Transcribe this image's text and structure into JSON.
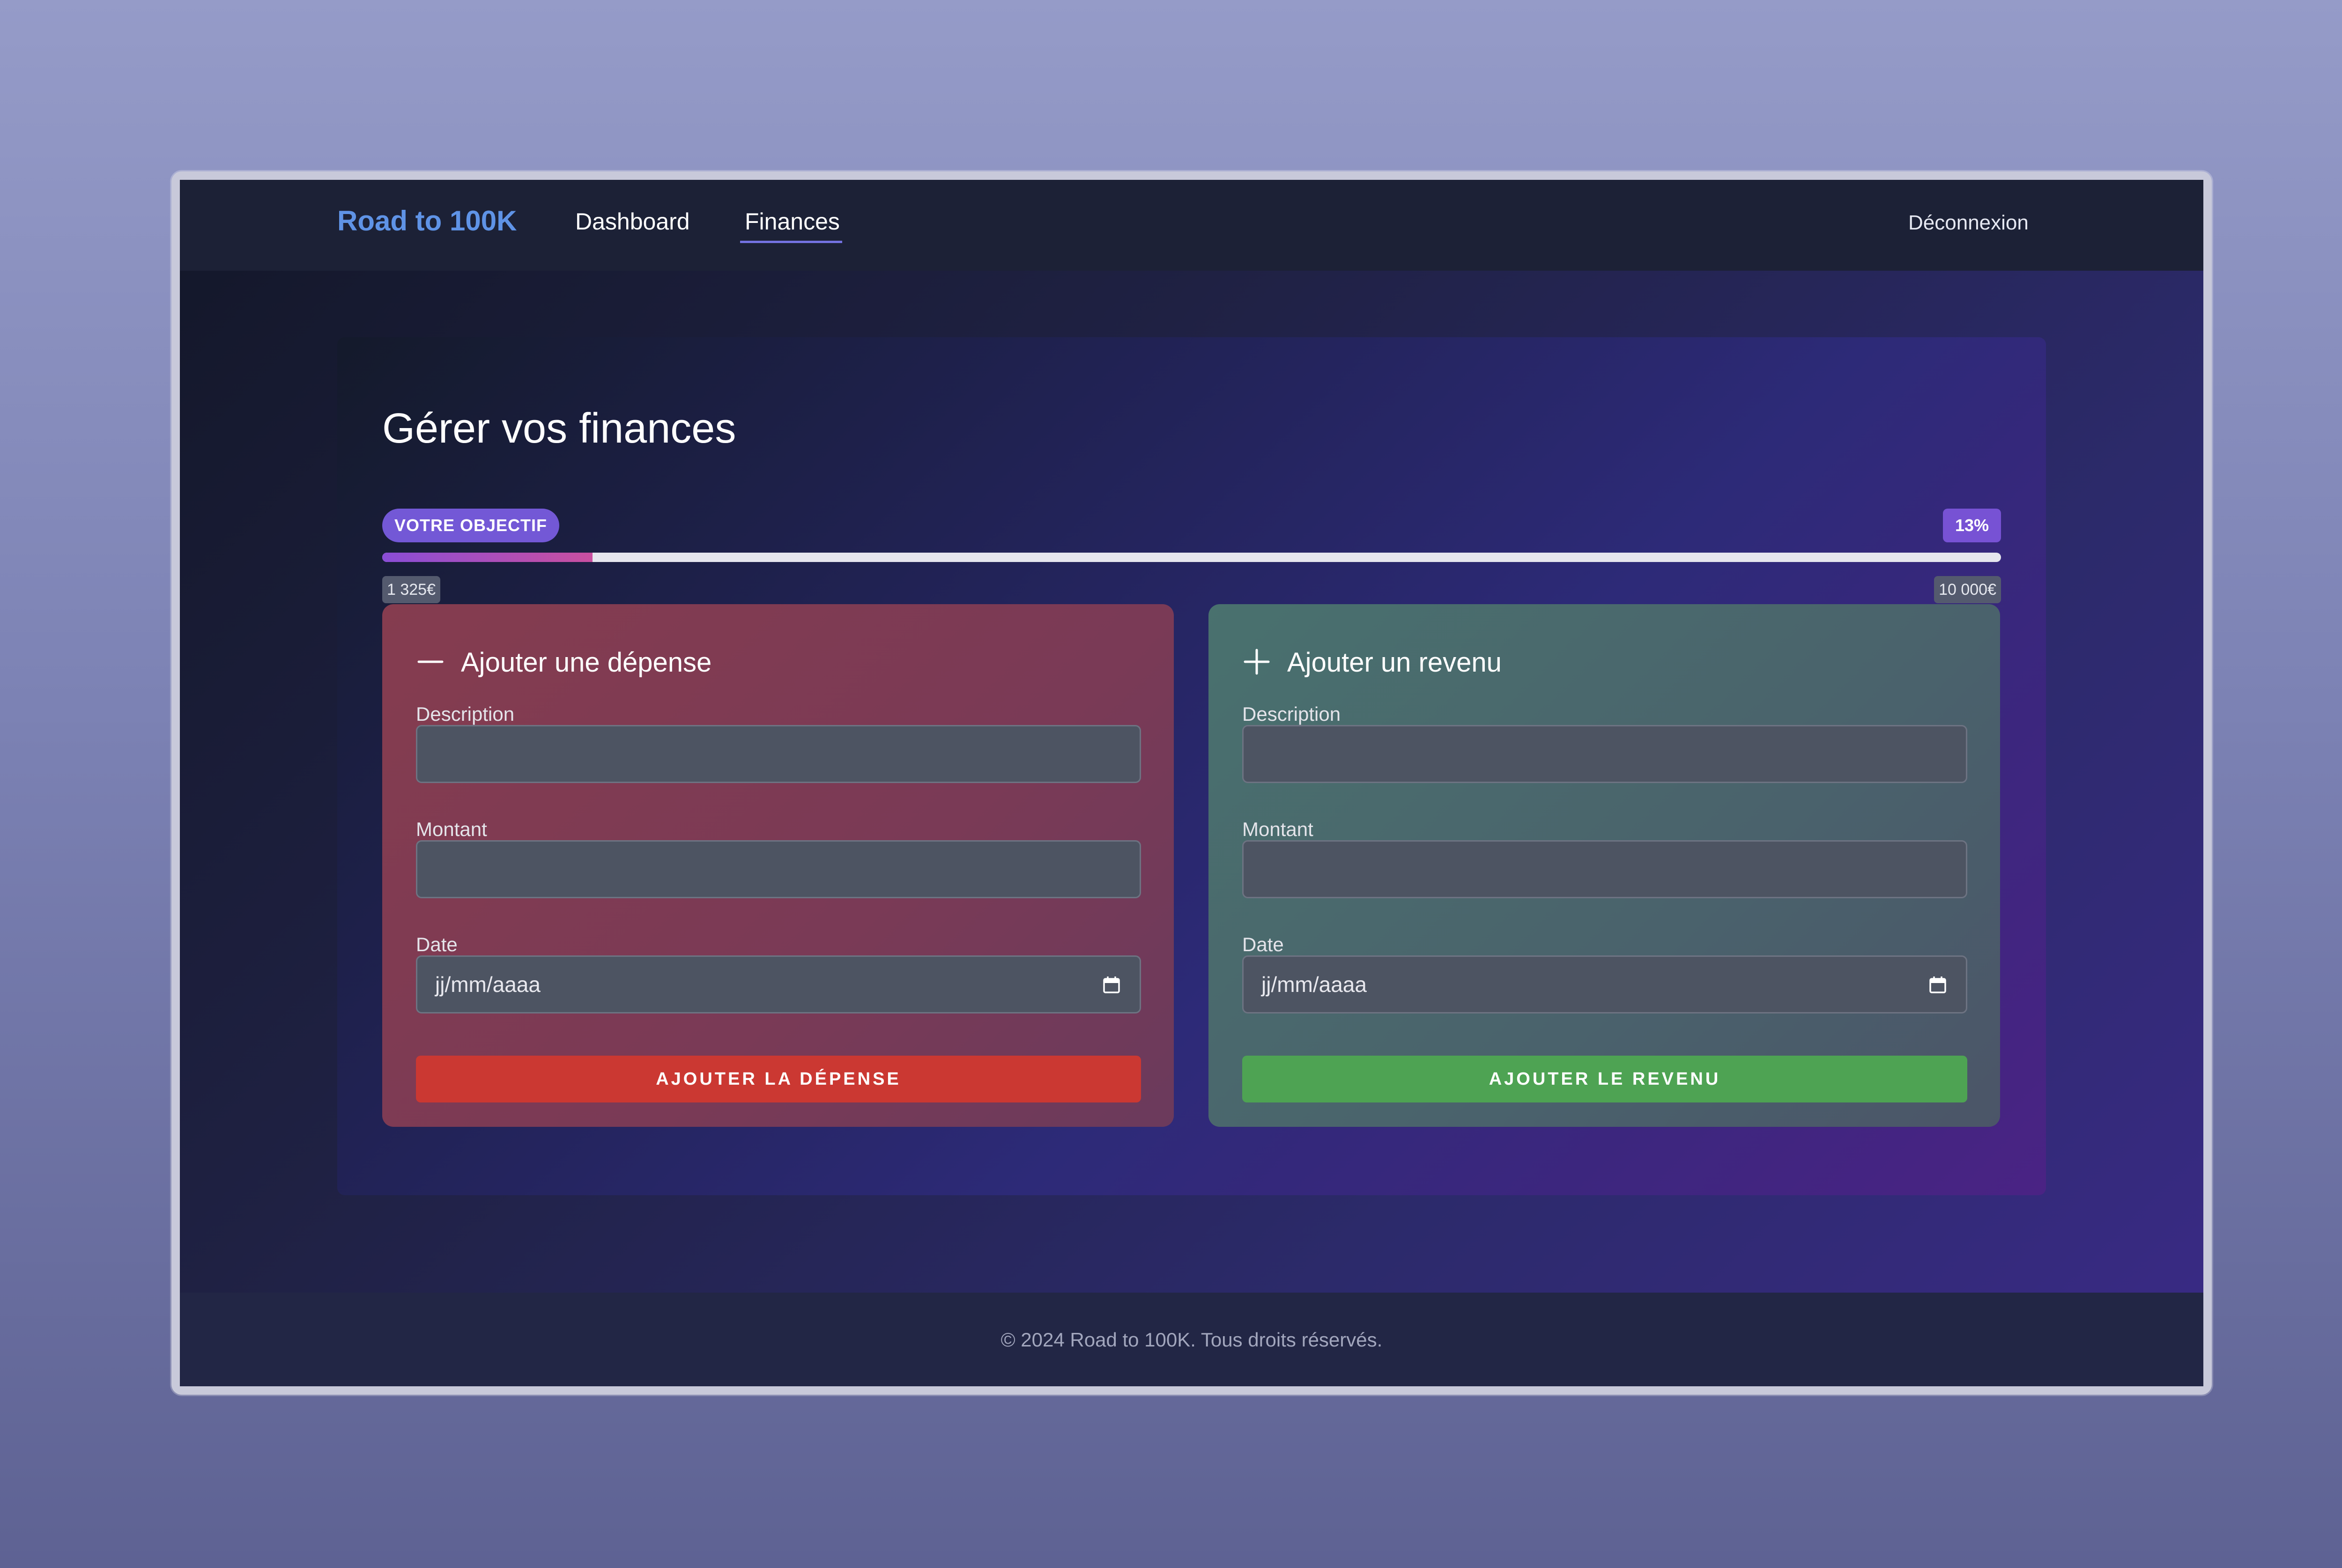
{
  "nav": {
    "brand": "Road to 100K",
    "links": [
      "Dashboard",
      "Finances"
    ],
    "active": "Finances",
    "logout_label": "Déconnexion"
  },
  "page": {
    "title": "Gérer vos finances"
  },
  "goal": {
    "badge_label": "VOTRE OBJECTIF",
    "percent_label": "13%",
    "progress_fraction": 0.13,
    "current_label": "1 325€",
    "target_label": "10 000€"
  },
  "expense": {
    "title": "Ajouter une dépense",
    "icon": "minus-icon",
    "description_label": "Description",
    "description_value": "",
    "amount_label": "Montant",
    "amount_value": "",
    "date_label": "Date",
    "date_placeholder": "jj/mm/aaaa",
    "submit_label": "AJOUTER LA DÉPENSE"
  },
  "income": {
    "title": "Ajouter un revenu",
    "icon": "plus-icon",
    "description_label": "Description",
    "description_value": "",
    "amount_label": "Montant",
    "amount_value": "",
    "date_label": "Date",
    "date_placeholder": "jj/mm/aaaa",
    "submit_label": "AJOUTER LE REVENU"
  },
  "footer": {
    "text": "© 2024 Road to 100K. Tous droits réservés."
  },
  "colors": {
    "brand": "#5f93e6",
    "accent": "#7358d6",
    "expense_button": "#cb3832",
    "income_button": "#4ea353"
  }
}
